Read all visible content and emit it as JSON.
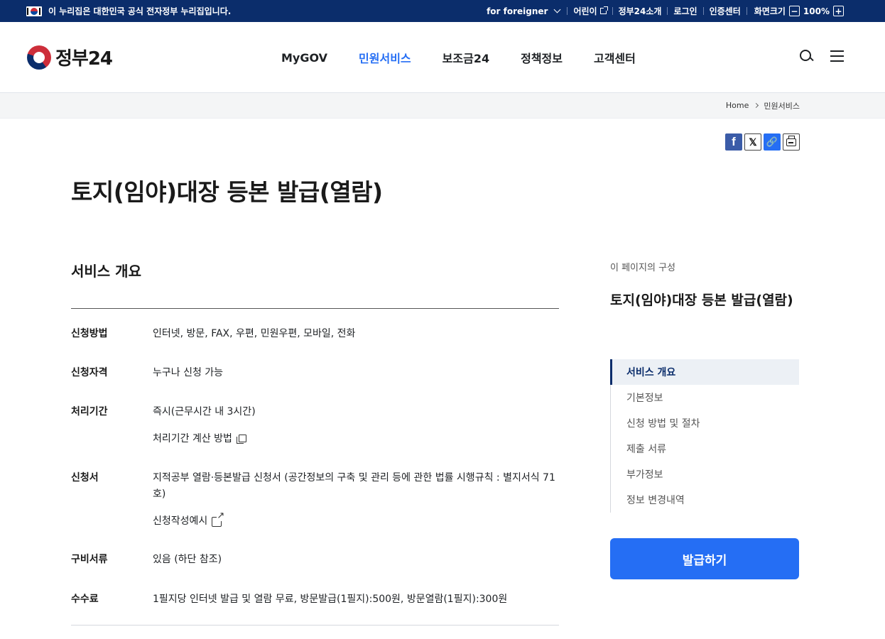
{
  "gov_bar": {
    "notice": "이 누리집은 대한민국 공식 전자정부 누리집입니다.",
    "links": [
      "for foreigner",
      "어린이",
      "정부24소개",
      "로그인",
      "인증센터",
      "화면크기"
    ],
    "zoom_minus": "−",
    "zoom_value": "100%",
    "zoom_plus": "+"
  },
  "header": {
    "logo_text": "정부24",
    "nav": [
      "MyGOV",
      "민원서비스",
      "보조금24",
      "정책정보",
      "고객센터"
    ],
    "active_nav": "민원서비스"
  },
  "breadcrumb": [
    "Home",
    "민원서비스"
  ],
  "share": {
    "facebook": "f",
    "x": "𝕏",
    "link": "🔗"
  },
  "page_title": "토지(임야)대장 등본 발급(열람)",
  "overview": {
    "title": "서비스 개요",
    "rows": [
      {
        "label": "신청방법",
        "value": "인터넷, 방문, FAX, 우편, 민원우편, 모바일, 전화"
      },
      {
        "label": "신청자격",
        "value": "누구나 신청 가능"
      },
      {
        "label": "처리기간",
        "value": "즉시(근무시간 내 3시간)",
        "sub": "처리기간 계산 방법"
      },
      {
        "label": "신청서",
        "value": "지적공부 열람·등본발급 신청서 (공간정보의 구축 및 관리 등에 관한 법률 시행규칙 : 별지서식 71호)",
        "sub": "신청작성예시"
      },
      {
        "label": "구비서류",
        "value": "있음 (하단 참조)"
      },
      {
        "label": "수수료",
        "value": "1필지당 인터넷 발급 및 열람 무료, 방문발급(1필지):500원, 방문열람(1필지):300원"
      }
    ]
  },
  "aside": {
    "label": "이 페이지의 구성",
    "title": "토지(임야)대장 등본 발급(열람)",
    "toc": [
      "서비스 개요",
      "기본정보",
      "신청 방법 및 절차",
      "제출 서류",
      "부가정보",
      "정보 변경내역"
    ],
    "active_toc": "서비스 개요",
    "issue_button": "발급하기"
  },
  "colors": {
    "gov_bar": "#0b2d6b",
    "accent": "#256ef4",
    "active_toc_bg": "#ecf0f5"
  }
}
